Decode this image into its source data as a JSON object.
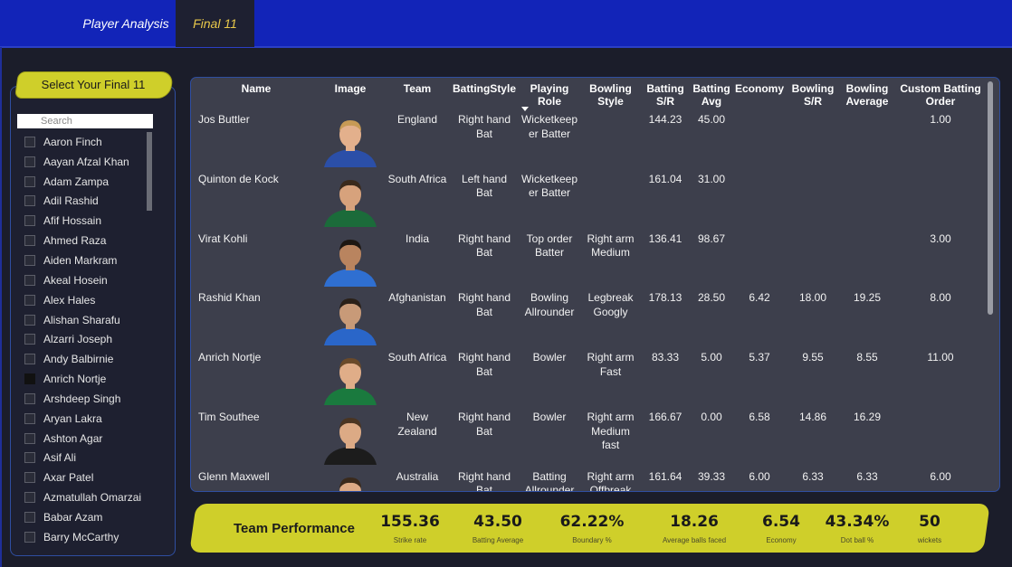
{
  "tabs": [
    {
      "label": "Player Analysis"
    },
    {
      "label": "Final 11"
    }
  ],
  "sidebar": {
    "button_label": "Select Your Final 11",
    "search_placeholder": "Search",
    "items": [
      {
        "label": "Aaron Finch",
        "checked": false
      },
      {
        "label": "Aayan Afzal Khan",
        "checked": false
      },
      {
        "label": "Adam Zampa",
        "checked": false
      },
      {
        "label": "Adil Rashid",
        "checked": false
      },
      {
        "label": "Afif Hossain",
        "checked": false
      },
      {
        "label": "Ahmed Raza",
        "checked": false
      },
      {
        "label": "Aiden Markram",
        "checked": false
      },
      {
        "label": "Akeal Hosein",
        "checked": false
      },
      {
        "label": "Alex Hales",
        "checked": false
      },
      {
        "label": "Alishan Sharafu",
        "checked": false
      },
      {
        "label": "Alzarri Joseph",
        "checked": false
      },
      {
        "label": "Andy Balbirnie",
        "checked": false
      },
      {
        "label": "Anrich Nortje",
        "checked": true
      },
      {
        "label": "Arshdeep Singh",
        "checked": false
      },
      {
        "label": "Aryan Lakra",
        "checked": false
      },
      {
        "label": "Ashton Agar",
        "checked": false
      },
      {
        "label": "Asif Ali",
        "checked": false
      },
      {
        "label": "Axar Patel",
        "checked": false
      },
      {
        "label": "Azmatullah Omarzai",
        "checked": false
      },
      {
        "label": "Babar Azam",
        "checked": false
      },
      {
        "label": "Barry McCarthy",
        "checked": false
      }
    ]
  },
  "table": {
    "headers": {
      "name": "Name",
      "image": "Image",
      "team": "Team",
      "batting_style": "BattingStyle",
      "playing_role": "Playing Role",
      "bowling_style": "Bowling\nStyle",
      "batting_sr": "Batting\nS/R",
      "batting_avg": "Batting\nAvg",
      "economy": "Economy",
      "bowling_sr": "Bowling\nS/R",
      "bowling_avg": "Bowling\nAverage",
      "custom_order": "Custom Batting\nOrder"
    },
    "rows": [
      {
        "name": "Jos Buttler",
        "team": "England",
        "batting_style": "Right hand\nBat",
        "playing_role": "Wicketkeep\ner Batter",
        "bowling_style": "",
        "batting_sr": "144.23",
        "batting_avg": "45.00",
        "economy": "",
        "bowling_sr": "",
        "bowling_avg": "",
        "custom_order": "1.00",
        "jersey": "#2b4fa8",
        "skin": "#e3b08c",
        "hair": "#c79a55"
      },
      {
        "name": "Quinton de Kock",
        "team": "South Africa",
        "batting_style": "Left hand\nBat",
        "playing_role": "Wicketkeep\ner Batter",
        "bowling_style": "",
        "batting_sr": "161.04",
        "batting_avg": "31.00",
        "economy": "",
        "bowling_sr": "",
        "bowling_avg": "",
        "custom_order": "",
        "jersey": "#1b6b3a",
        "skin": "#d7a27c",
        "hair": "#3a2a1c"
      },
      {
        "name": "Virat Kohli",
        "team": "India",
        "batting_style": "Right hand\nBat",
        "playing_role": "Top order\nBatter",
        "bowling_style": "Right arm\nMedium",
        "batting_sr": "136.41",
        "batting_avg": "98.67",
        "economy": "",
        "bowling_sr": "",
        "bowling_avg": "",
        "custom_order": "3.00",
        "jersey": "#2f6fd1",
        "skin": "#b9845f",
        "hair": "#1d1712"
      },
      {
        "name": "Rashid Khan",
        "team": "Afghanistan",
        "batting_style": "Right hand\nBat",
        "playing_role": "Bowling\nAllrounder",
        "bowling_style": "Legbreak\nGoogly",
        "batting_sr": "178.13",
        "batting_avg": "28.50",
        "economy": "6.42",
        "bowling_sr": "18.00",
        "bowling_avg": "19.25",
        "custom_order": "8.00",
        "jersey": "#2a66c9",
        "skin": "#c89a78",
        "hair": "#2a2018"
      },
      {
        "name": "Anrich Nortje",
        "team": "South Africa",
        "batting_style": "Right hand\nBat",
        "playing_role": "Bowler",
        "bowling_style": "Right arm\nFast",
        "batting_sr": "83.33",
        "batting_avg": "5.00",
        "economy": "5.37",
        "bowling_sr": "9.55",
        "bowling_avg": "8.55",
        "custom_order": "11.00",
        "jersey": "#1a7a3e",
        "skin": "#e0ad88",
        "hair": "#6a4a2a"
      },
      {
        "name": "Tim Southee",
        "team": "New\nZealand",
        "batting_style": "Right hand\nBat",
        "playing_role": "Bowler",
        "bowling_style": "Right arm\nMedium\nfast",
        "batting_sr": "166.67",
        "batting_avg": "0.00",
        "economy": "6.58",
        "bowling_sr": "14.86",
        "bowling_avg": "16.29",
        "custom_order": "",
        "jersey": "#1c1c1c",
        "skin": "#dcaa85",
        "hair": "#4a3522"
      },
      {
        "name": "Glenn Maxwell",
        "team": "Australia",
        "batting_style": "Right hand\nBat",
        "playing_role": "Batting\nAllrounder",
        "bowling_style": "Right arm\nOffbreak",
        "batting_sr": "161.64",
        "batting_avg": "39.33",
        "economy": "6.00",
        "bowling_sr": "6.33",
        "bowling_avg": "6.33",
        "custom_order": "6.00",
        "jersey": "#2a6a3a",
        "skin": "#dcaa85",
        "hair": "#3a2a1c"
      }
    ]
  },
  "team_performance": {
    "title": "Team Performance",
    "kpis": [
      {
        "value": "155.36",
        "label": "Strike rate"
      },
      {
        "value": "43.50",
        "label": "Batting Average"
      },
      {
        "value": "62.22%",
        "label": "Boundary %"
      },
      {
        "value": "18.26",
        "label": "Average balls faced"
      },
      {
        "value": "6.54",
        "label": "Economy"
      },
      {
        "value": "43.34%",
        "label": "Dot ball %"
      },
      {
        "value": "50",
        "label": "wickets"
      }
    ]
  },
  "colors": {
    "topbar": "#1224b8",
    "accent_yellow": "#cfcf2a",
    "active_tab_text": "#e8c84a",
    "table_bg": "#3d3f4c",
    "page_bg": "#1b1d2a"
  }
}
